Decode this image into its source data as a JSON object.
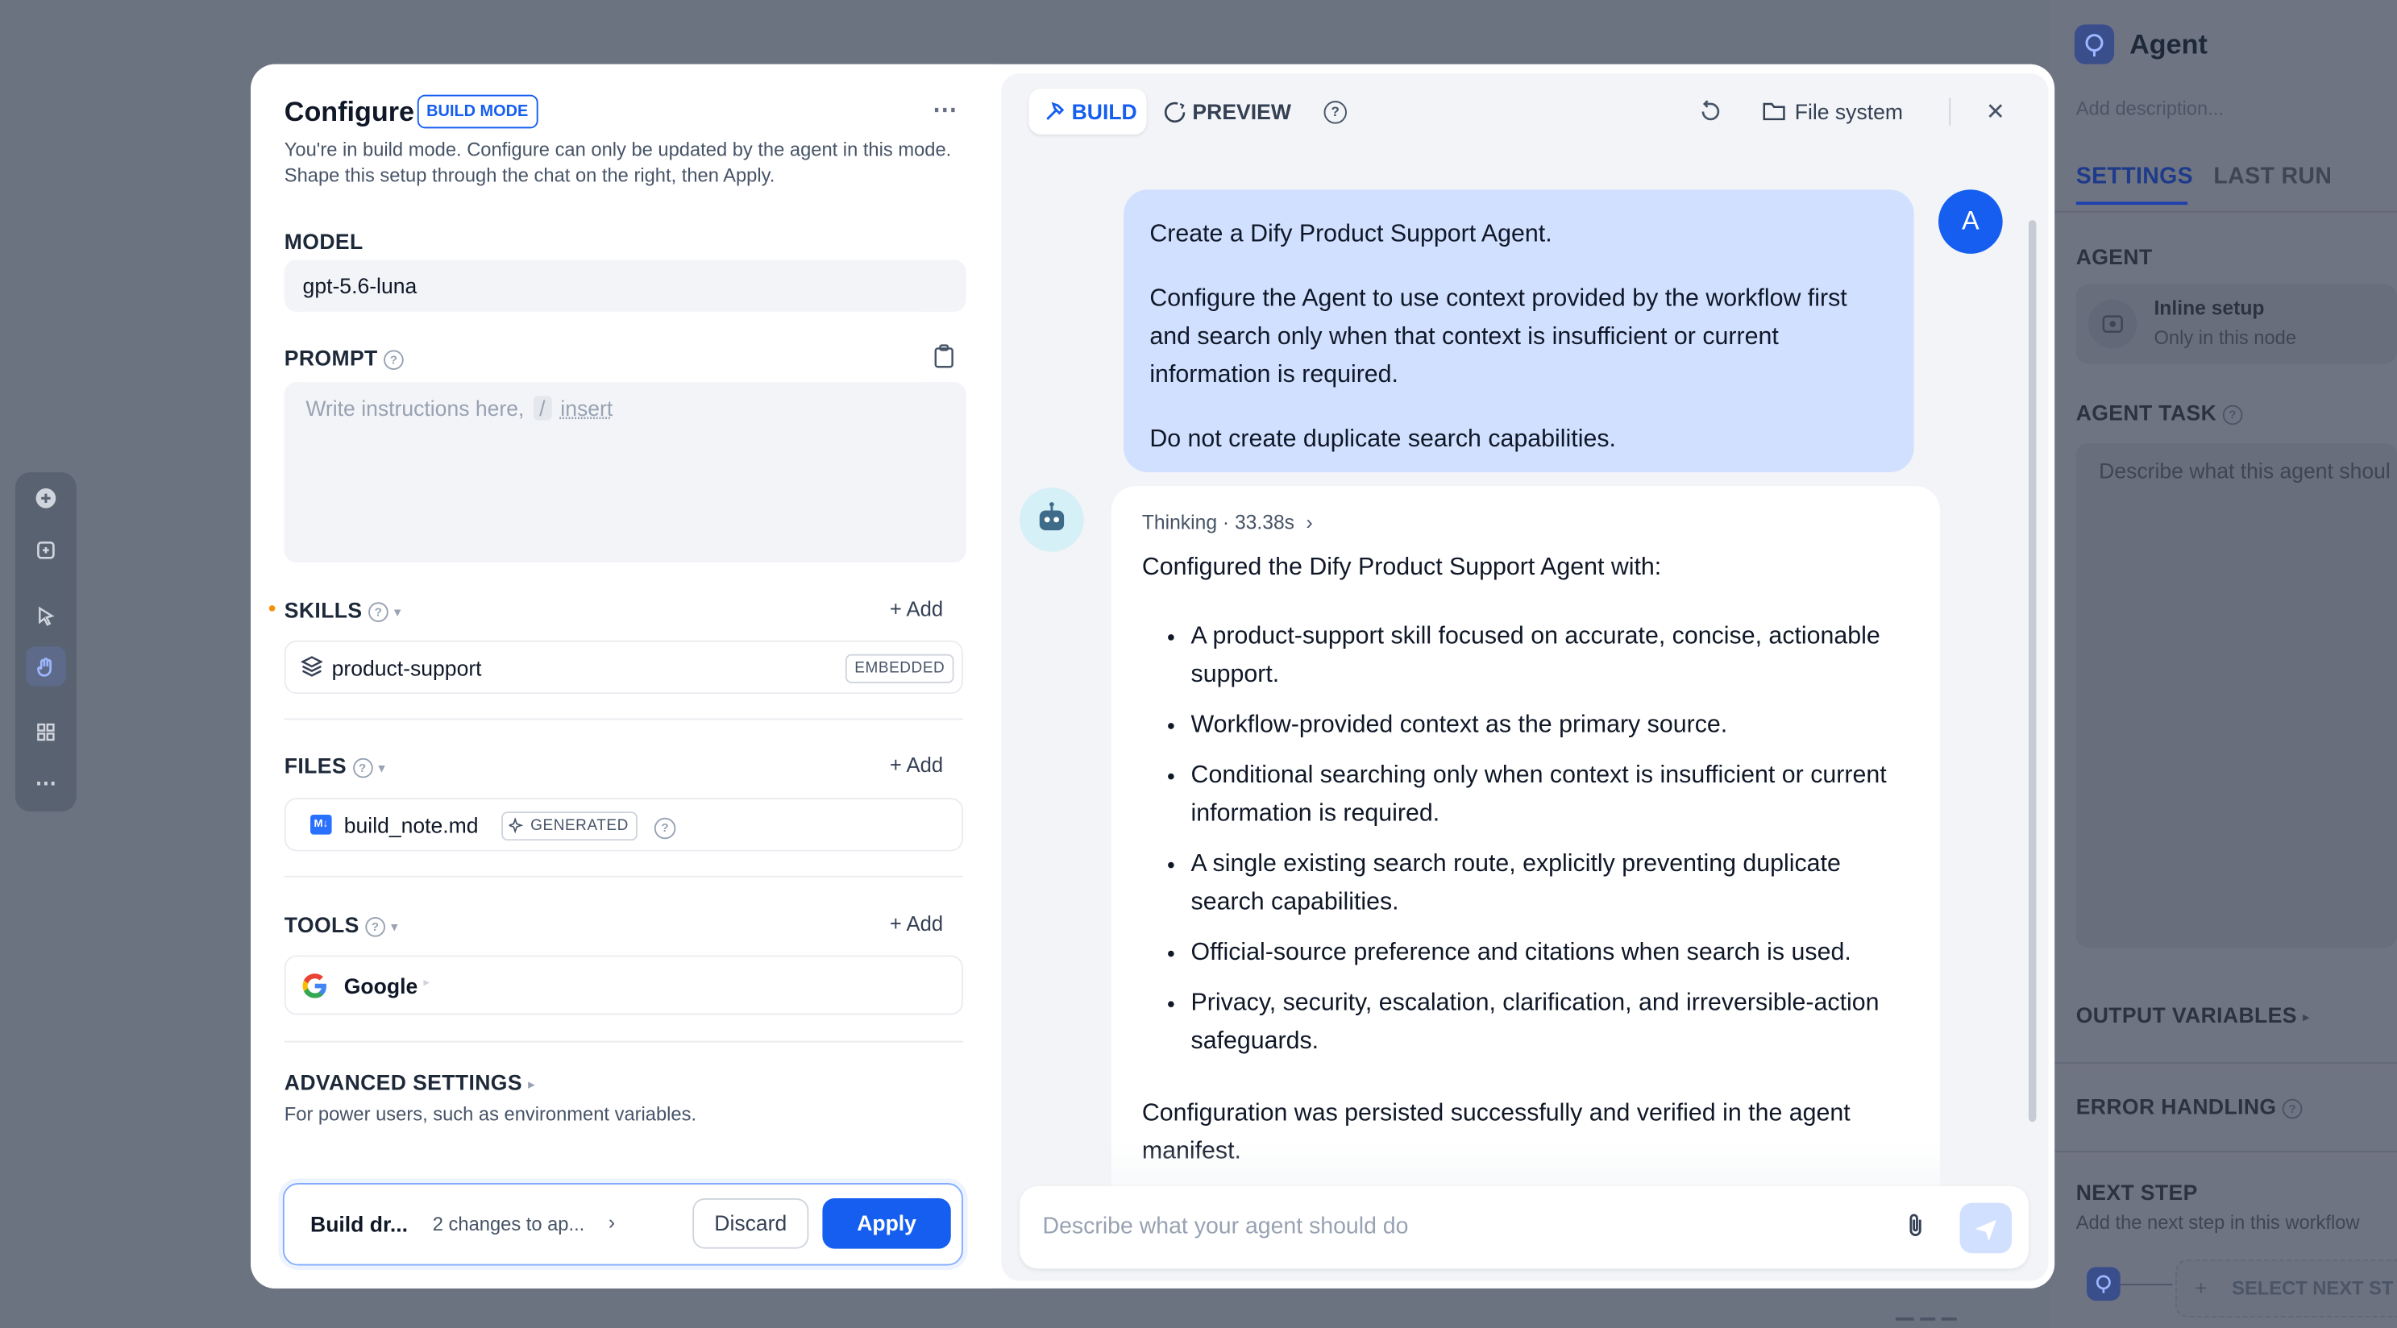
{
  "background_panel": {
    "title": "Agent",
    "description_placeholder": "Add description...",
    "tabs": [
      "SETTINGS",
      "LAST RUN"
    ],
    "agent_label": "AGENT",
    "inline_setup_title": "Inline setup",
    "inline_setup_sub": "Only in this node",
    "agent_task_label": "AGENT TASK",
    "agent_task_placeholder": "Describe what this agent shoul",
    "output_variables": "OUTPUT VARIABLES",
    "error_handling": "ERROR HANDLING",
    "next_step_title": "NEXT STEP",
    "next_step_sub": "Add the next step in this workflow",
    "select_next_step": "SELECT NEXT ST"
  },
  "configure": {
    "title": "Configure",
    "badge": "BUILD MODE",
    "description": "You're in build mode. Configure can only be updated by the agent in this mode. Shape this setup through the chat on the right, then Apply.",
    "model_label": "MODEL",
    "model_value": "gpt-5.6-luna",
    "prompt_label": "PROMPT",
    "prompt_placeholder": "Write instructions here,",
    "prompt_slash": "/",
    "prompt_insert": "insert",
    "skills_label": "SKILLS",
    "files_label": "FILES",
    "tools_label": "TOOLS",
    "add_label": "Add",
    "skill_name": "product-support",
    "skill_badge": "EMBEDDED",
    "file_name": "build_note.md",
    "file_badge": "GENERATED",
    "tool_name": "Google",
    "advanced_label": "ADVANCED SETTINGS",
    "advanced_desc": "For power users, such as environment variables.",
    "footer": {
      "draft_label": "Build dr...",
      "changes_label": "2 changes to ap...",
      "discard": "Discard",
      "apply": "Apply"
    }
  },
  "chat": {
    "tab_build": "BUILD",
    "tab_preview": "PREVIEW",
    "file_system": "File system",
    "user_avatar": "A",
    "user_message": [
      "Create a Dify Product Support Agent.",
      "Configure the Agent to use context provided by the workflow first and search only when that context is insufficient or current information is required.",
      "Do not create duplicate search capabilities."
    ],
    "thinking_label": "Thinking",
    "thinking_time": "33.38s",
    "assistant_intro": "Configured the Dify Product Support Agent with:",
    "assistant_bullets": [
      "A product-support skill focused on accurate, concise, actionable support.",
      "Workflow-provided context as the primary source.",
      "Conditional searching only when context is insufficient or current information is required.",
      "A single existing search route, explicitly preventing duplicate search capabilities.",
      "Official-source preference and citations when search is used.",
      "Privacy, security, escalation, clarification, and irreversible-action safeguards."
    ],
    "assistant_outro": "Configuration was persisted successfully and verified in the agent manifest.",
    "input_placeholder": "Describe what your agent should do"
  },
  "colors": {
    "accent": "#155eef",
    "overlay": "#6b7280",
    "user_bubble": "#d1e0ff",
    "chat_bg": "#f2f4f7"
  }
}
